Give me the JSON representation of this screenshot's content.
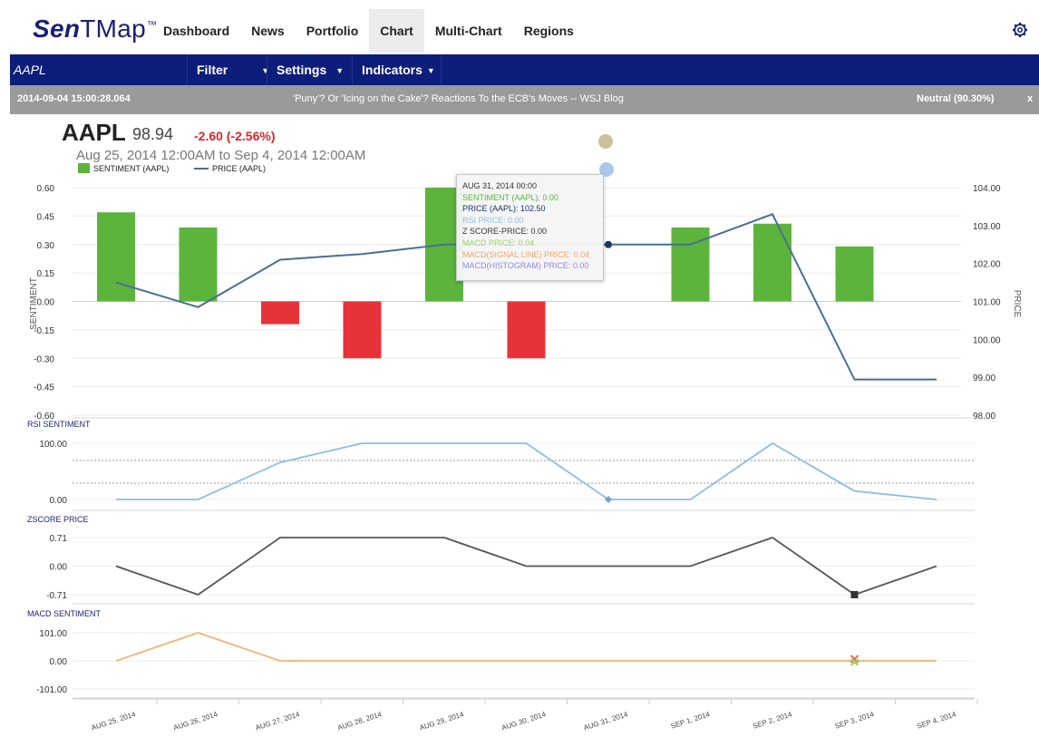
{
  "app": {
    "logo_sen": "Sen",
    "logo_rest": "TMap",
    "logo_tm": "™"
  },
  "nav": {
    "items": [
      {
        "label": "Dashboard",
        "active": false
      },
      {
        "label": "News",
        "active": false
      },
      {
        "label": "Portfolio",
        "active": false
      },
      {
        "label": "Chart",
        "active": true
      },
      {
        "label": "Multi-Chart",
        "active": false
      },
      {
        "label": "Regions",
        "active": false
      }
    ],
    "settings_icon": "gear-icon"
  },
  "toolbar": {
    "ticker": "AAPL",
    "filter": "Filter",
    "settings": "Settings",
    "indicators": "Indicators",
    "caret": "▼"
  },
  "news": {
    "timestamp": "2014-09-04 15:00:28.064",
    "headline": "'Puny'? Or 'Icing on the Cake'? Reactions To the ECB's Moves -- WSJ Blog",
    "sentiment": "Neutral (90.30%)",
    "close": "x"
  },
  "quote": {
    "symbol": "AAPL",
    "price": "98.94",
    "change": "-2.60 (-2.56%)",
    "range": "Aug 25, 2014 12:00AM to Sep 4, 2014 12:00AM"
  },
  "colors": {
    "positive_bar": "#5cb43c",
    "negative_bar": "#e8323a",
    "price_line": "#4a6f94",
    "rsi_line": "#8fbde2",
    "zscore_line": "#555555",
    "macd_line": "#f0a868",
    "navy": "#0c1d7a"
  },
  "chart_data": [
    {
      "type": "bar",
      "legend": [
        "SENTIMENT (AAPL)",
        "PRICE (AAPL)"
      ],
      "ylabel": "SENTIMENT",
      "y2label": "PRICE",
      "categories": [
        "AUG 25, 2014",
        "AUG 26, 2014",
        "AUG 27, 2014",
        "AUG 28, 2014",
        "AUG 29, 2014",
        "AUG 30, 2014",
        "AUG 31, 2014",
        "SEP 1, 2014",
        "SEP 2, 2014",
        "SEP 3, 2014",
        "SEP 4, 2014"
      ],
      "y_ticks": [
        "0.60",
        "0.45",
        "0.30",
        "0.15",
        "0.00",
        "-0.15",
        "-0.30",
        "-0.45",
        "-0.60"
      ],
      "y2_ticks": [
        "104.00",
        "103.00",
        "102.00",
        "101.00",
        "100.00",
        "99.00",
        "98.00"
      ],
      "ylim": [
        -0.6,
        0.6
      ],
      "y2lim": [
        98,
        104
      ],
      "series": [
        {
          "name": "SENTIMENT (AAPL)",
          "kind": "bar",
          "values": [
            0.47,
            0.39,
            -0.12,
            -0.3,
            0.6,
            -0.3,
            0.0,
            0.39,
            0.41,
            0.29,
            null
          ]
        },
        {
          "name": "PRICE (AAPL)",
          "kind": "line",
          "values": [
            101.5,
            100.85,
            102.1,
            102.25,
            102.5,
            102.5,
            102.5,
            102.5,
            103.3,
            98.94,
            98.94
          ]
        }
      ]
    },
    {
      "type": "line",
      "title": "RSI SENTIMENT",
      "y_ticks": [
        "100.00",
        "0.00"
      ],
      "ylim": [
        0,
        100
      ],
      "series": [
        {
          "name": "RSI PRICE",
          "values": [
            0,
            0,
            66,
            100,
            100,
            100,
            0,
            0,
            100,
            15,
            0
          ]
        }
      ]
    },
    {
      "type": "line",
      "title": "ZSCORE PRICE",
      "y_ticks": [
        "0.71",
        "0.00",
        "-0.71"
      ],
      "ylim": [
        -0.71,
        0.71
      ],
      "series": [
        {
          "name": "Z SCORE-PRICE",
          "values": [
            0,
            -0.71,
            0.71,
            0.71,
            0.71,
            0,
            0,
            0,
            0.71,
            -0.71,
            0
          ]
        }
      ]
    },
    {
      "type": "line",
      "title": "MACD SENTIMENT",
      "y_ticks": [
        "101.00",
        "0.00",
        "-101.00"
      ],
      "ylim": [
        -101,
        101
      ],
      "series": [
        {
          "name": "MACD PRICE",
          "values": [
            0,
            101,
            0,
            0,
            0,
            0,
            0,
            0,
            0,
            0,
            0
          ]
        },
        {
          "name": "MACD(SIGNAL LINE) PRICE",
          "values": [
            0,
            101,
            0,
            0,
            0,
            0,
            0,
            0,
            0,
            0,
            0
          ]
        }
      ]
    }
  ],
  "tooltip": {
    "date": "AUG 31, 2014 00:00",
    "sentiment": "SENTIMENT (AAPL): 0.00",
    "price": "PRICE (AAPL): 102.50",
    "rsi": "RSI PRICE: 0.00",
    "zscore": "Z SCORE-PRICE: 0.00",
    "macd": "MACD PRICE: 0.04",
    "signal": "MACD(SIGNAL LINE) PRICE: 0.04",
    "histogram": "MACD(HISTOGRAM) PRICE: 0.00"
  }
}
